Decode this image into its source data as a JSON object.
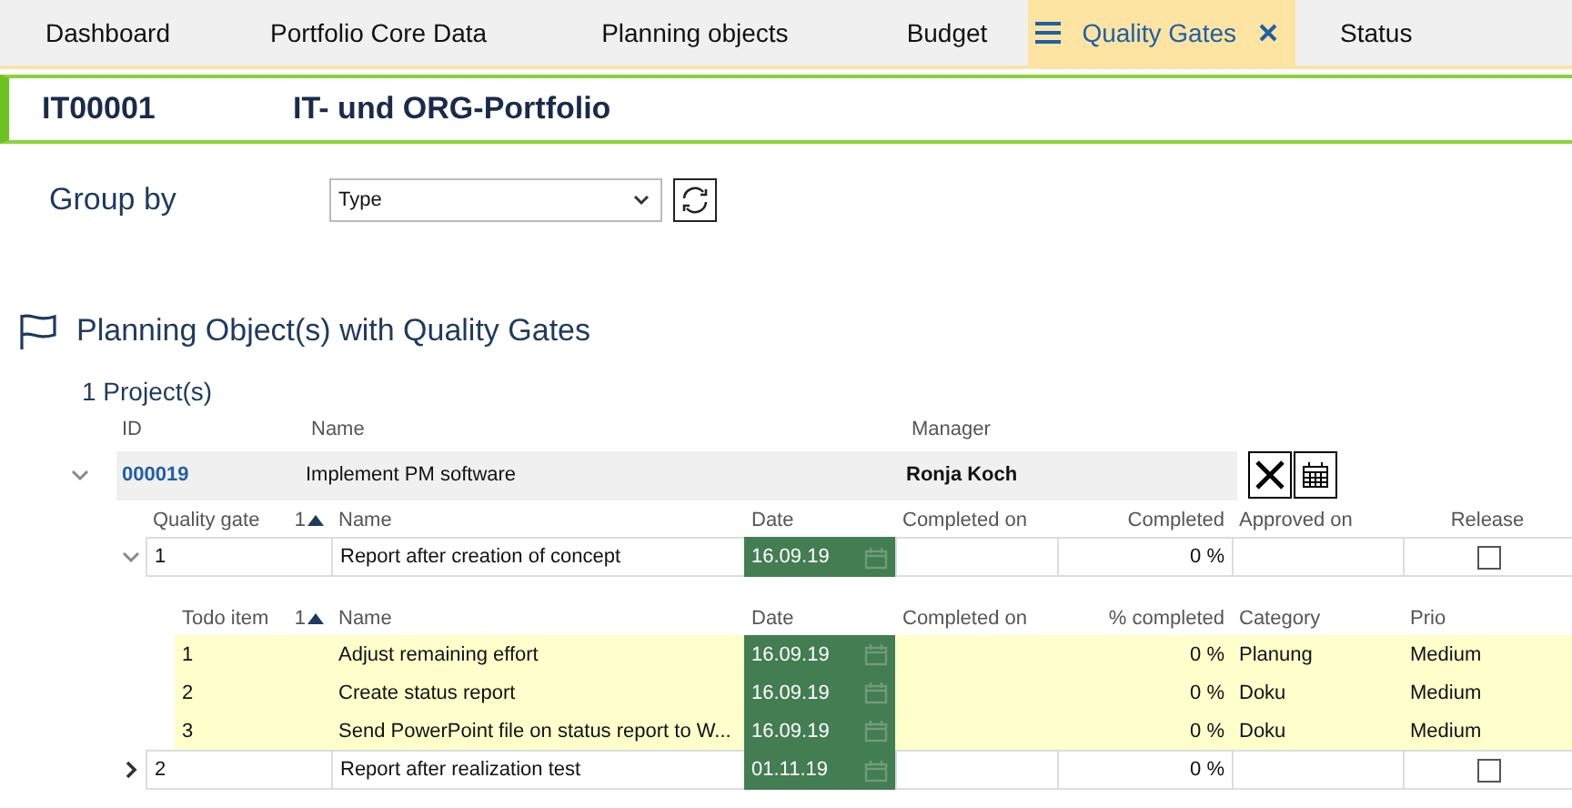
{
  "tabs": [
    {
      "label": "Dashboard",
      "selected": false
    },
    {
      "label": "Portfolio Core Data",
      "selected": false
    },
    {
      "label": "Planning objects",
      "selected": false
    },
    {
      "label": "Budget",
      "selected": false
    },
    {
      "label": "Quality Gates",
      "selected": true
    },
    {
      "label": "Status",
      "selected": false
    }
  ],
  "header": {
    "id": "IT00001",
    "title": "IT- und ORG-Portfolio"
  },
  "group_by": {
    "label": "Group by",
    "value": "Type"
  },
  "section": {
    "title": "Planning Object(s) with Quality Gates",
    "count": "1 Project(s)"
  },
  "project_columns": [
    "ID",
    "Name",
    "Manager"
  ],
  "projects": [
    {
      "id": "000019",
      "name": "Implement PM software",
      "manager": "Ronja Koch",
      "expanded": true,
      "gate_columns": [
        {
          "label": "Quality gate",
          "sort": "1"
        },
        {
          "label": "Name"
        },
        {
          "label": "Date"
        },
        {
          "label": "Completed on"
        },
        {
          "label": "Completed"
        },
        {
          "label": "Approved on"
        },
        {
          "label": "Release"
        }
      ],
      "gates": [
        {
          "number": "1",
          "name": "Report after creation of concept",
          "date": "16.09.19",
          "completed": "0 %",
          "release": false,
          "expanded": true,
          "todo_columns": [
            {
              "label": "Todo item",
              "sort": "1"
            },
            {
              "label": "Name"
            },
            {
              "label": "Date"
            },
            {
              "label": "Completed on"
            },
            {
              "label": "% completed"
            },
            {
              "label": "Category"
            },
            {
              "label": "Prio"
            }
          ],
          "todos": [
            {
              "number": "1",
              "name": "Adjust remaining effort",
              "date": "16.09.19",
              "completed": "0 %",
              "category": "Planung",
              "prio": "Medium"
            },
            {
              "number": "2",
              "name": "Create status report",
              "date": "16.09.19",
              "completed": "0 %",
              "category": "Doku",
              "prio": "Medium"
            },
            {
              "number": "3",
              "name": "Send PowerPoint file on status report to W...",
              "date": "16.09.19",
              "completed": "0 %",
              "category": "Doku",
              "prio": "Medium"
            }
          ]
        },
        {
          "number": "2",
          "name": "Report after realization test",
          "date": "01.11.19",
          "completed": "0 %",
          "release": false,
          "expanded": false
        }
      ]
    }
  ]
}
